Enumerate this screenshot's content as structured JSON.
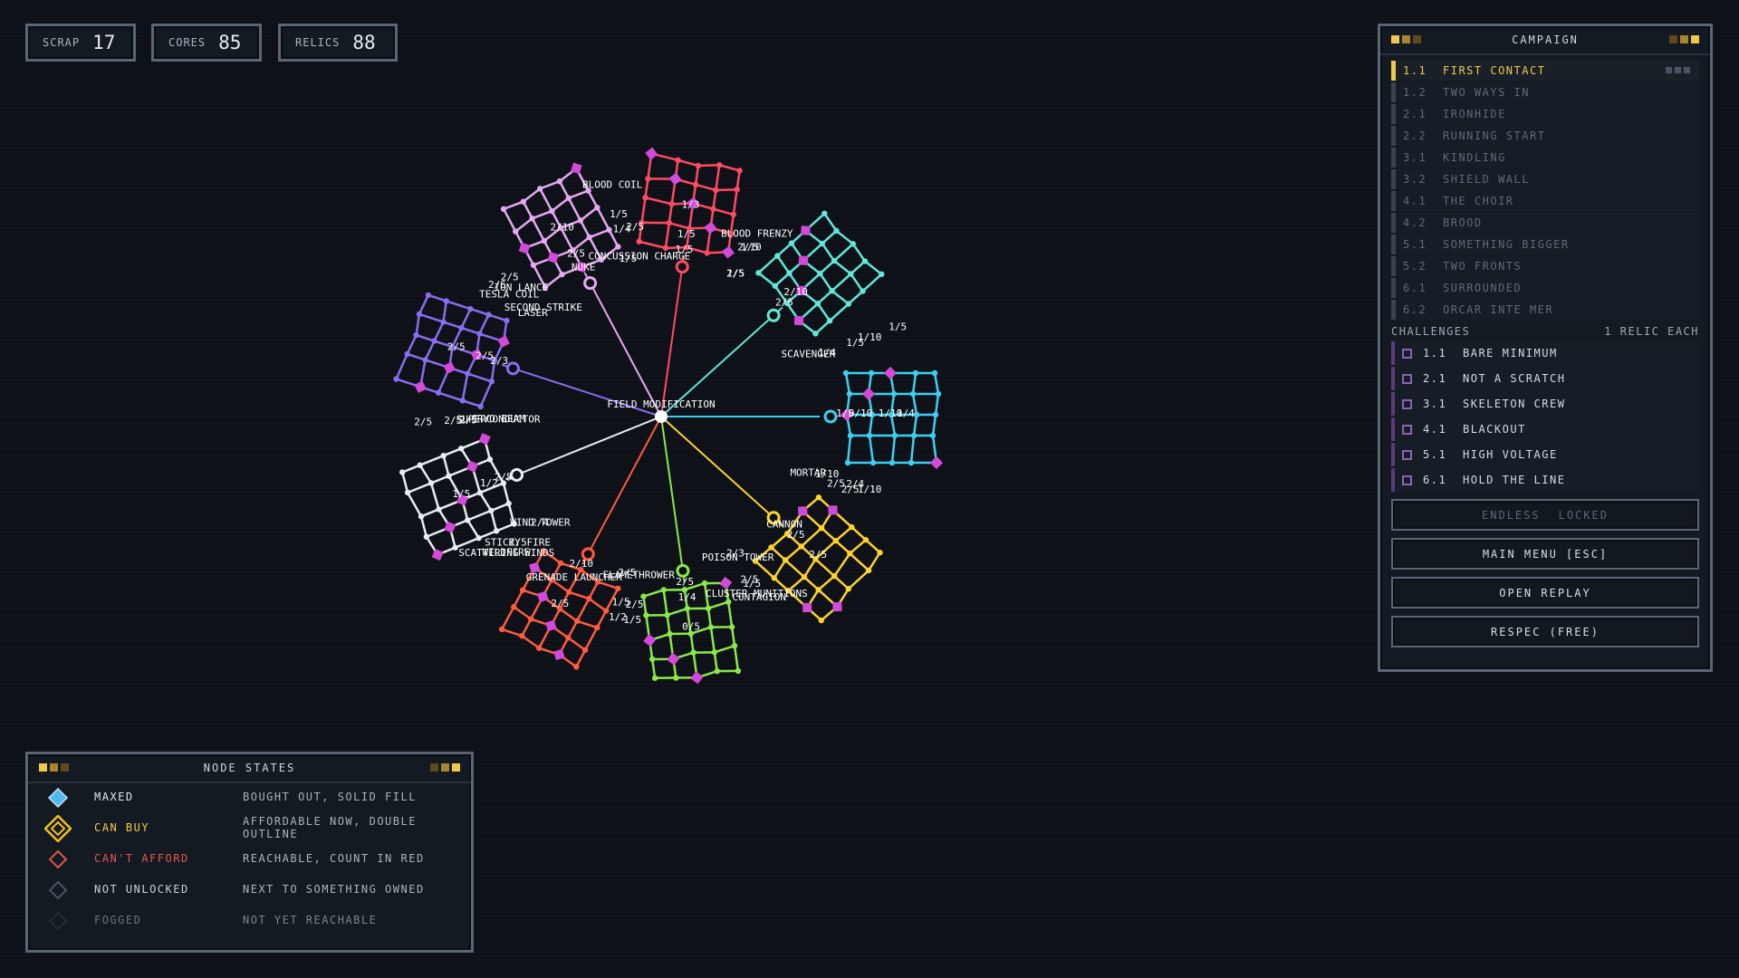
{
  "resources": [
    {
      "label": "SCRAP",
      "value": "17"
    },
    {
      "label": "CORES",
      "value": "85"
    },
    {
      "label": "RELICS",
      "value": "88"
    }
  ],
  "tree": {
    "center_label": "FIELD MODIFICATION",
    "branches": [
      {
        "color": "#ff4a63",
        "labels": [
          "1/5",
          "1/5",
          "1/5",
          "1/4",
          "1/5",
          "1/5",
          "1/5",
          "1/3",
          "BLOOD FRENZY",
          "BLOOD COIL"
        ]
      },
      {
        "color": "#5fe8d8",
        "labels": [
          "2/5",
          "2/5",
          "SCAVENGER",
          "2/10",
          "2/10"
        ]
      },
      {
        "color": "#3ecff0",
        "labels": [
          "1/4",
          "1/5",
          "1/10",
          "1/5",
          "0/10",
          "2/4",
          "1/10",
          "1/10",
          "1/10",
          "1/5",
          "1/4"
        ]
      },
      {
        "color": "#ffd22e",
        "labels": [
          "MORTAR",
          "CANNON",
          "2/3",
          "2/5",
          "2/5",
          "2/5",
          "2/5",
          "2/5",
          "CLUSTER MUNITIONS"
        ]
      },
      {
        "color": "#8be84a",
        "labels": [
          "POISON TOWER",
          "2/5",
          "2/5",
          "1/5",
          "1/4",
          "1/5",
          "CONTAGION",
          "0/5",
          "1/2"
        ]
      },
      {
        "color": "#ff5a40",
        "labels": [
          "FLAMETHROWER",
          "2/10",
          "2/4",
          "2/5",
          "GRENADE LAUNCHER",
          "STICKY FIRE",
          "1/5",
          "2/5",
          "WILDFIRE"
        ]
      },
      {
        "color": "#e8ecf2",
        "labels": [
          "WIND TOWER",
          "2/5",
          "CRYO BEAM",
          "2/5",
          "1/2",
          "2/5",
          "SCATTERING WINDS",
          "1/5"
        ]
      },
      {
        "color": "#8a6cf0",
        "labels": [
          "SUPERCONDUCTOR",
          "2/3",
          "LASER",
          "2/5",
          "2/5",
          "TESLA COIL",
          "2/5",
          "2/5",
          "2/6",
          "2/5"
        ]
      },
      {
        "color": "#e6a8f2",
        "labels": [
          "SECOND STRIKE",
          "NUKE",
          "CONCUSSION CHARGE",
          "ION LANCE",
          "2/5",
          "2/5",
          "2/5",
          "2/10"
        ]
      }
    ]
  },
  "campaign": {
    "title": "CAMPAIGN",
    "missions": [
      {
        "num": "1.1",
        "name": "FIRST CONTACT"
      },
      {
        "num": "1.2",
        "name": "TWO WAYS IN"
      },
      {
        "num": "2.1",
        "name": "IRONHIDE"
      },
      {
        "num": "2.2",
        "name": "RUNNING START"
      },
      {
        "num": "3.1",
        "name": "KINDLING"
      },
      {
        "num": "3.2",
        "name": "SHIELD WALL"
      },
      {
        "num": "4.1",
        "name": "THE CHOIR"
      },
      {
        "num": "4.2",
        "name": "BROOD"
      },
      {
        "num": "5.1",
        "name": "SOMETHING BIGGER"
      },
      {
        "num": "5.2",
        "name": "TWO FRONTS"
      },
      {
        "num": "6.1",
        "name": "SURROUNDED"
      },
      {
        "num": "6.2",
        "name": "ORCAR INTE MER"
      }
    ],
    "challenges_title": "CHALLENGES",
    "challenges_note": "1 RELIC EACH",
    "challenges": [
      {
        "num": "1.1",
        "name": "BARE MINIMUM"
      },
      {
        "num": "2.1",
        "name": "NOT A SCRATCH"
      },
      {
        "num": "3.1",
        "name": "SKELETON CREW"
      },
      {
        "num": "4.1",
        "name": "BLACKOUT"
      },
      {
        "num": "5.1",
        "name": "HIGH VOLTAGE"
      },
      {
        "num": "6.1",
        "name": "HOLD THE LINE"
      }
    ],
    "endless_label": "ENDLESS",
    "endless_state": "LOCKED",
    "main_menu": "MAIN MENU [ESC]",
    "open_replay": "OPEN REPLAY",
    "respec": "RESPEC (FREE)"
  },
  "legend": {
    "title": "NODE STATES",
    "rows": [
      {
        "state": "MAXED",
        "desc": "BOUGHT OUT, SOLID FILL",
        "color": "#4fb8f0"
      },
      {
        "state": "CAN BUY",
        "desc": "AFFORDABLE NOW, DOUBLE OUTLINE",
        "color": "#f0c020"
      },
      {
        "state": "CAN'T AFFORD",
        "desc": "REACHABLE, COUNT IN RED",
        "color": "#d9534f"
      },
      {
        "state": "NOT UNLOCKED",
        "desc": "NEXT TO SOMETHING OWNED",
        "color": "#4a5563"
      },
      {
        "state": "FOGGED",
        "desc": "NOT YET REACHABLE",
        "color": "#252c35"
      }
    ]
  }
}
